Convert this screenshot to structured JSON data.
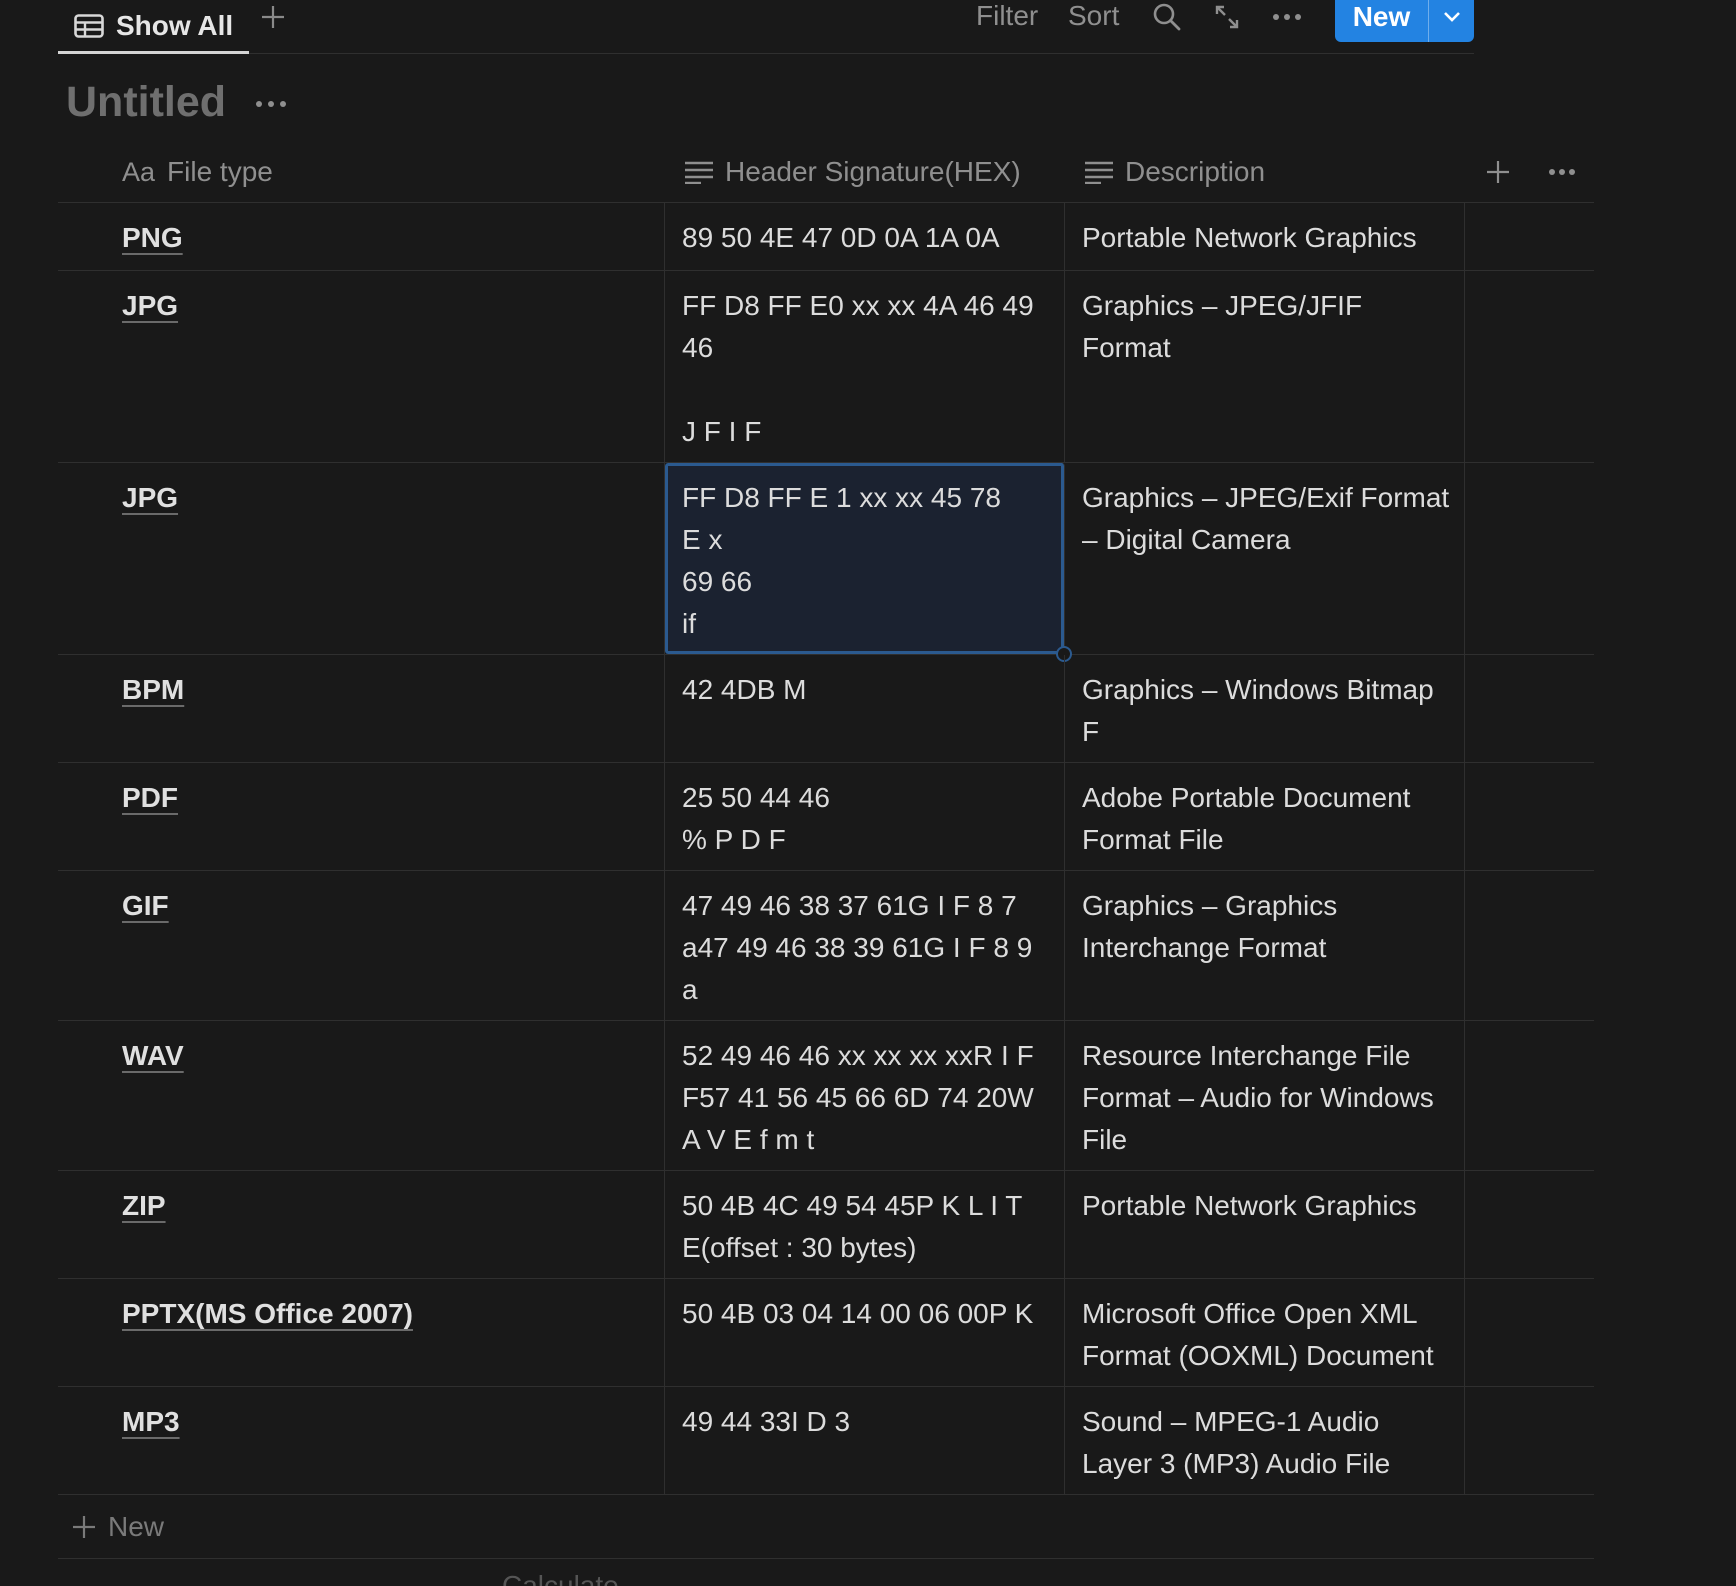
{
  "toolbar": {
    "view_tab": "Show All",
    "filter": "Filter",
    "sort": "Sort",
    "new_button": "New"
  },
  "page": {
    "title": "Untitled"
  },
  "table": {
    "columns": [
      {
        "prefix": "Aa",
        "label": "File type",
        "icon": "title-icon"
      },
      {
        "label": "Header Signature(HEX)",
        "icon": "text-lines-icon"
      },
      {
        "label": "Description",
        "icon": "text-lines-icon"
      }
    ],
    "rows": [
      {
        "name": "PNG",
        "signature": "89 50 4E 47 0D 0A 1A 0A",
        "description": "Portable Network Graphics"
      },
      {
        "name": "JPG",
        "signature": "FF D8 FF E0 xx xx 4A 46 49 46\n\nJ F I F",
        "description": "Graphics – JPEG/JFIF Format"
      },
      {
        "name": "JPG",
        "signature": "FF D8 FF E 1 xx xx 45 78\nE x\n69 66\nif",
        "description": "Graphics – JPEG/Exif Format – Digital Camera"
      },
      {
        "name": "BPM",
        "signature": "42 4DB M",
        "description": "Graphics – Windows Bitmap F"
      },
      {
        "name": "PDF",
        "signature": "25 50 44 46\n% P D F",
        "description": "Adobe Portable Document Format File"
      },
      {
        "name": "GIF",
        "signature": "47 49 46 38 37 61G I F 8 7 a47 49 46 38 39 61G I F 8 9 a",
        "description": "Graphics – Graphics Interchange Format"
      },
      {
        "name": "WAV",
        "signature": "52 49 46 46 xx xx xx xxR I F F57 41 56 45 66 6D 74 20W A V E f m t",
        "description": "Resource Interchange File Format – Audio for Windows File"
      },
      {
        "name": "ZIP",
        "signature": "50 4B 4C 49 54 45P K L I T E(offset : 30 bytes)",
        "description": "Portable Network Graphics"
      },
      {
        "name": "PPTX(MS Office 2007)",
        "signature": "50 4B 03 04 14 00 06 00P K",
        "description": "Microsoft Office Open XML Format (OOXML) Document"
      },
      {
        "name": "MP3",
        "signature": "49 44 33I D 3",
        "description": "Sound – MPEG-1 Audio Layer 3 (MP3) Audio File"
      }
    ],
    "new_row_label": "New",
    "calculate_label": "Calculate"
  },
  "colors": {
    "background": "#191919",
    "accent": "#2383e2",
    "selected_border": "#2b5a8f"
  }
}
